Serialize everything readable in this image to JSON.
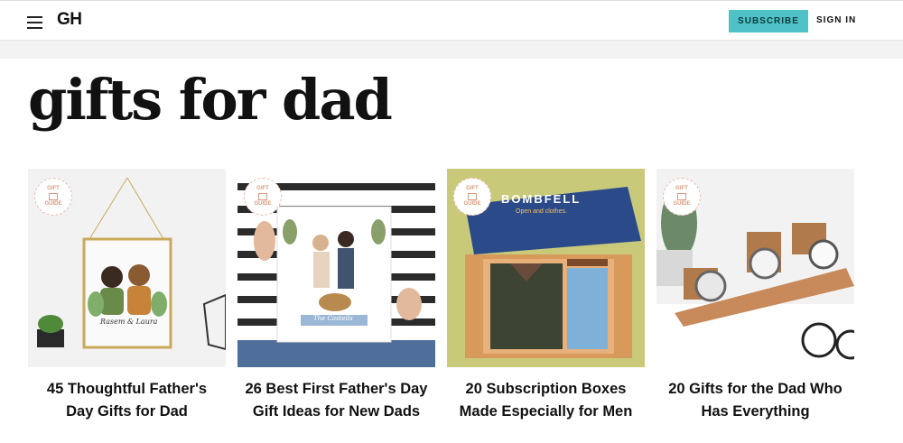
{
  "header": {
    "logo": "GH",
    "subscribe_label": "SUBSCRIBE",
    "signin_label": "SIGN IN",
    "accent": "#4ec2c6"
  },
  "page": {
    "title": "gifts for dad"
  },
  "badge": {
    "line1": "GIFT",
    "line2": "GUIDE"
  },
  "cards": [
    {
      "caption": "45 Thoughtful Father's Day Gifts for Dad",
      "image_text": "Rasem & Laura"
    },
    {
      "caption": "26 Best First Father's Day Gift Ideas for New Dads",
      "image_text": "The Castells"
    },
    {
      "caption": "20 Subscription Boxes Made Especially for Men",
      "image_text": "BOMBFELL",
      "image_subtext": "Open and clothes."
    },
    {
      "caption": "20 Gifts for the Dad Who Has Everything",
      "image_text": ""
    }
  ]
}
